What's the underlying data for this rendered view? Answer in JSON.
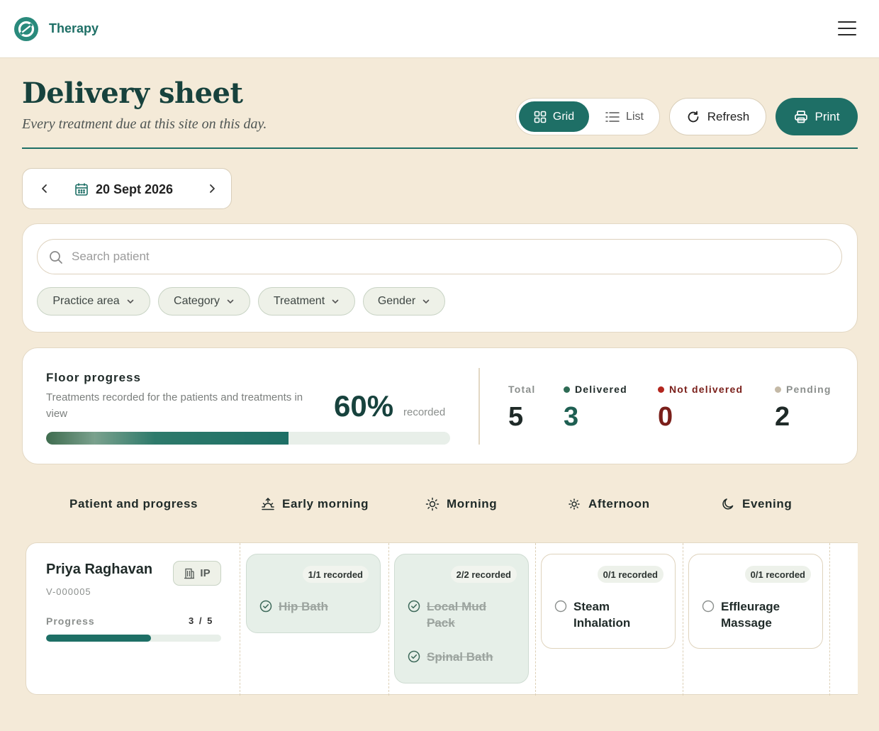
{
  "app": {
    "name": "Therapy"
  },
  "page": {
    "title": "Delivery sheet",
    "subtitle": "Every treatment due at this site on this day."
  },
  "toolbar": {
    "grid_label": "Grid",
    "list_label": "List",
    "refresh_label": "Refresh",
    "print_label": "Print",
    "active_view": "grid"
  },
  "date": {
    "value": "20 Sept 2026"
  },
  "filters": {
    "search_placeholder": "Search patient",
    "chips": [
      "Practice area",
      "Category",
      "Treatment",
      "Gender"
    ]
  },
  "floor_progress": {
    "title": "Floor progress",
    "description": "Treatments recorded for the patients and treatments in view",
    "percent_label": "60%",
    "percent_value": 60,
    "recorded_label": "recorded",
    "stats": [
      {
        "label": "Total",
        "value": "5",
        "color": "#8b8f8d",
        "dot": ""
      },
      {
        "label": "Delivered",
        "value": "3",
        "color": "#1e6f66",
        "dot": "#2e6b55"
      },
      {
        "label": "Not delivered",
        "value": "0",
        "color": "#7a1f1a",
        "dot": "#b3261e"
      },
      {
        "label": "Pending",
        "value": "2",
        "color": "#8b8f8d",
        "dot": "#c4b9a6"
      }
    ]
  },
  "schedule": {
    "headers": [
      "Patient and progress",
      "Early morning",
      "Morning",
      "Afternoon",
      "Evening"
    ],
    "header_icons": [
      "",
      "sunrise-icon",
      "sun-icon",
      "sun-small-icon",
      "moon-icon"
    ]
  },
  "patients": [
    {
      "name": "Priya Raghavan",
      "id": "V-000005",
      "badge": "IP",
      "progress_label": "Progress",
      "progress_text": "3 / 5",
      "progress_fraction": 0.6,
      "slots": [
        {
          "badge": "1/1 recorded",
          "status": "done",
          "treatments": [
            {
              "name": "Hip Bath",
              "done": true
            }
          ]
        },
        {
          "badge": "2/2 recorded",
          "status": "done",
          "treatments": [
            {
              "name": "Local Mud Pack",
              "done": true
            },
            {
              "name": "Spinal Bath",
              "done": true
            }
          ]
        },
        {
          "badge": "0/1 recorded",
          "status": "open",
          "treatments": [
            {
              "name": "Steam Inhalation",
              "done": false
            }
          ]
        },
        {
          "badge": "0/1 recorded",
          "status": "open",
          "treatments": [
            {
              "name": "Effleurage Massage",
              "done": false
            }
          ]
        }
      ]
    }
  ]
}
